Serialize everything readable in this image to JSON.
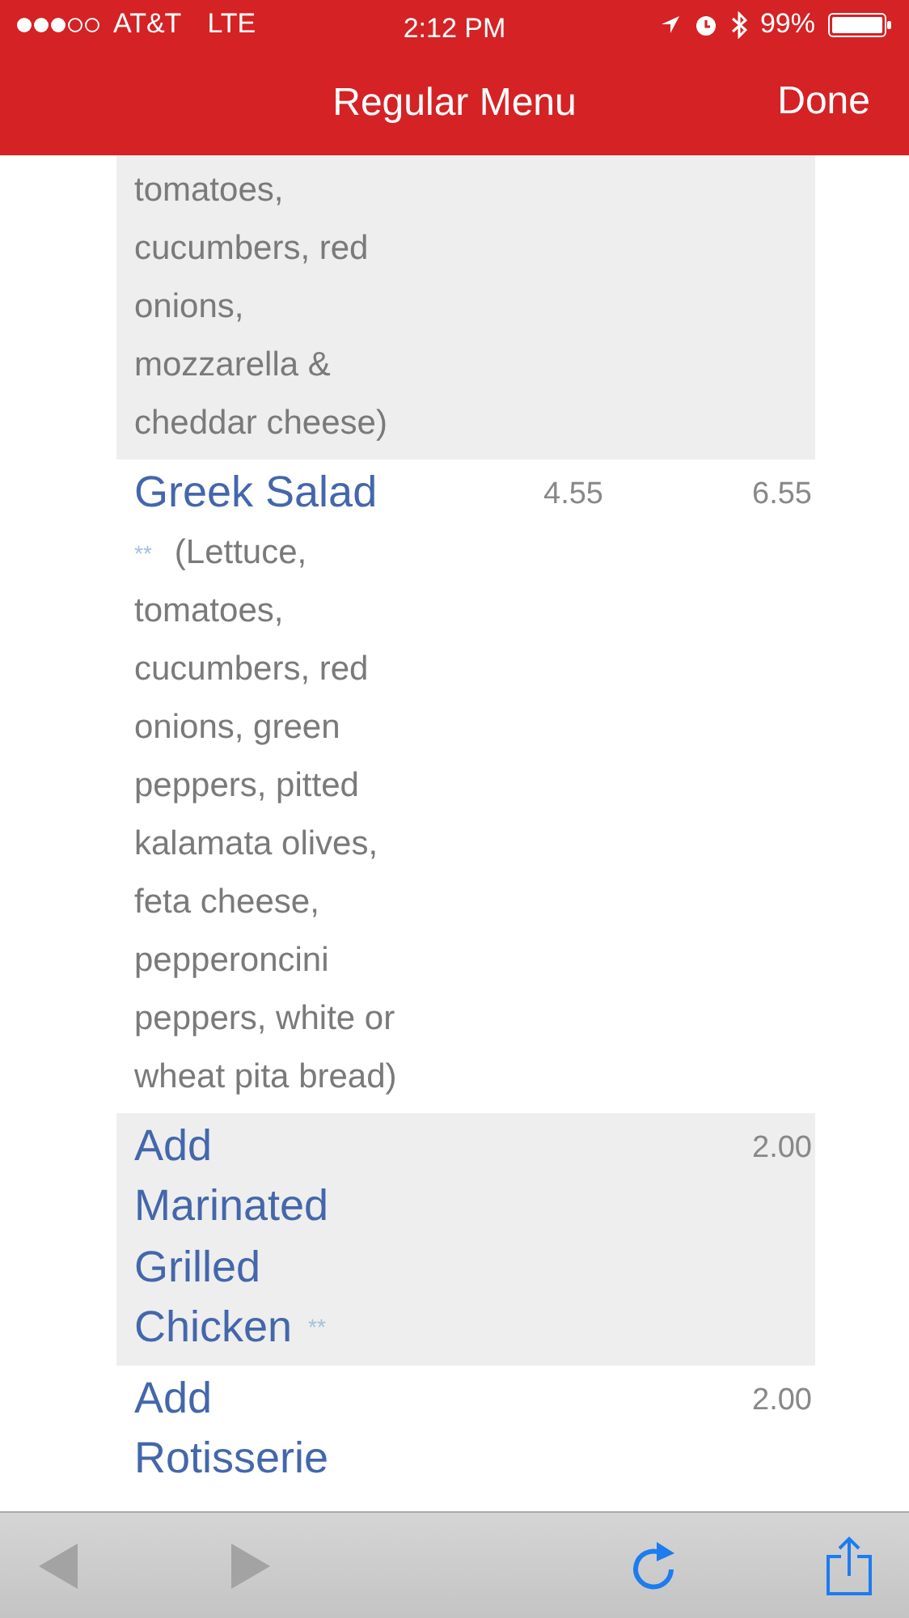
{
  "status_bar": {
    "carrier": "AT&T",
    "network": "LTE",
    "time": "2:12 PM",
    "battery": "99%"
  },
  "nav_bar": {
    "title": "Regular Menu",
    "done": "Done"
  },
  "menu_items": [
    {
      "description": "tomatoes, cucumbers, red onions, mozzarella & cheddar cheese)",
      "shaded": true
    },
    {
      "name": "Greek Salad",
      "stars": "**",
      "description": "(Lettuce, tomatoes, cucumbers, red onions, green peppers, pitted kalamata olives, feta cheese, pepperoncini peppers, white or wheat pita bread)",
      "price_1": "4.55",
      "price_2": "6.55",
      "shaded": false
    },
    {
      "name": "Add Marinated Grilled Chicken",
      "stars": "**",
      "price_2": "2.00",
      "shaded": true
    },
    {
      "name": "Add Rotisserie",
      "price_2": "2.00",
      "shaded": false
    }
  ],
  "toolbar": [
    {
      "kind": "back",
      "disabled": true
    },
    {
      "kind": "forward",
      "disabled": true
    },
    {
      "kind": "reload",
      "disabled": false
    },
    {
      "kind": "share",
      "disabled": false
    }
  ]
}
